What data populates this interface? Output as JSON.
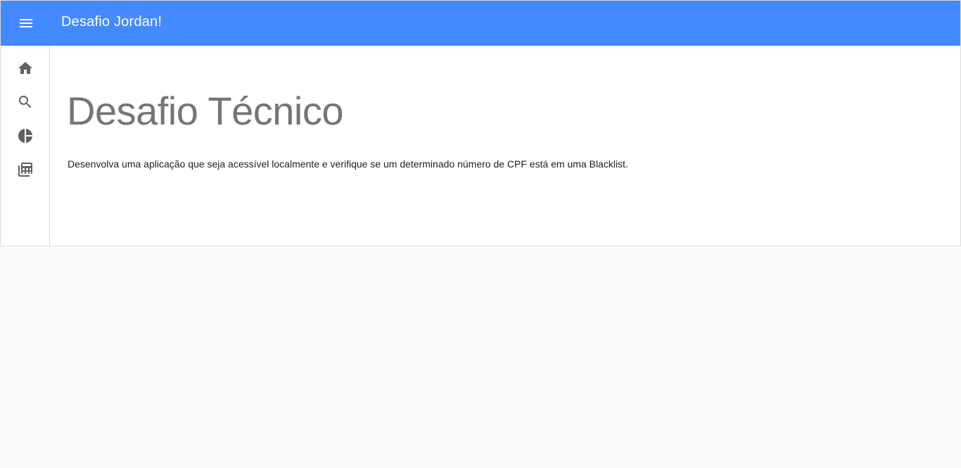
{
  "header": {
    "title": "Desafio Jordan!",
    "menu_icon": "menu-icon",
    "background_color": "#448aff"
  },
  "sidebar": {
    "items": [
      {
        "icon": "home-icon",
        "name": "home"
      },
      {
        "icon": "search-icon",
        "name": "search"
      },
      {
        "icon": "pie-chart-icon",
        "name": "chart"
      },
      {
        "icon": "table-icon",
        "name": "table"
      }
    ]
  },
  "main": {
    "title": "Desafio Técnico",
    "description": "Desenvolva uma aplicação que seja acessível localmente e verifique se um determinado número de CPF está em uma Blacklist."
  }
}
